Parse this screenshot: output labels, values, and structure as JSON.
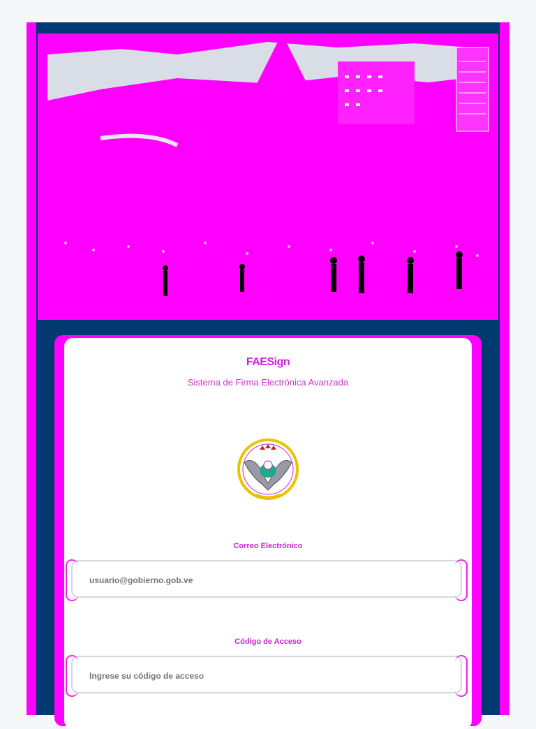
{
  "app": {
    "title": "FAESign",
    "subtitle": "Sistema de Firma Electrónica Avanzada"
  },
  "hero": {
    "image": "military-parade-photo"
  },
  "emblem": {
    "image": "air-force-emblem"
  },
  "form": {
    "email": {
      "label": "Correo Electrónico",
      "placeholder": "usuario@gobierno.gob.ve"
    },
    "code": {
      "label": "Código de Acceso",
      "placeholder": "Ingrese su código de acceso"
    }
  },
  "colors": {
    "primary": "#003a70",
    "accent": "#ff00ff",
    "background": "#f6f7f9"
  }
}
